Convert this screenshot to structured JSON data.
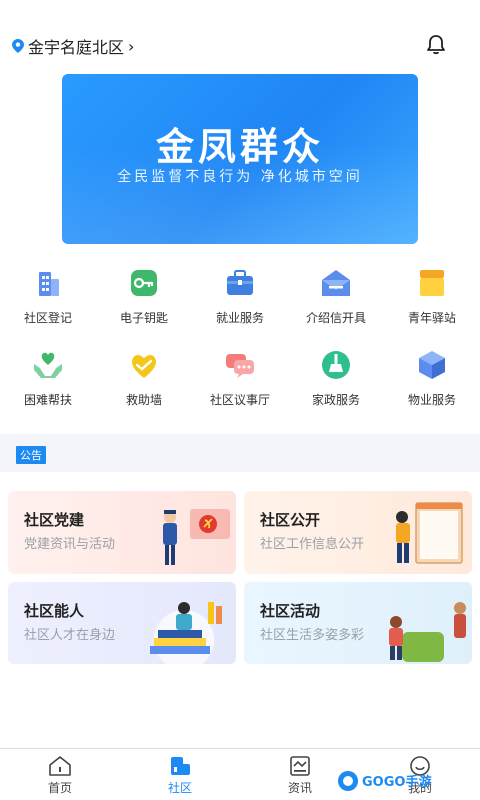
{
  "location": {
    "name": "金宇名庭北区"
  },
  "banner": {
    "title": "金凤群众",
    "subtitle": "全民监督不良行为  净化城市空间"
  },
  "services": [
    {
      "label": "社区登记",
      "icon": "building-icon"
    },
    {
      "label": "电子钥匙",
      "icon": "key-icon"
    },
    {
      "label": "就业服务",
      "icon": "briefcase-icon"
    },
    {
      "label": "介绍信开具",
      "icon": "letter-icon"
    },
    {
      "label": "青年驿站",
      "icon": "youth-station-icon"
    },
    {
      "label": "困难帮扶",
      "icon": "heart-hands-icon"
    },
    {
      "label": "救助墙",
      "icon": "handshake-heart-icon"
    },
    {
      "label": "社区议事厅",
      "icon": "chat-bubbles-icon"
    },
    {
      "label": "家政服务",
      "icon": "broom-icon"
    },
    {
      "label": "物业服务",
      "icon": "cube-icon"
    }
  ],
  "notice": {
    "badge": "公告"
  },
  "cards": [
    {
      "title": "社区党建",
      "subtitle": "党建资讯与活动"
    },
    {
      "title": "社区公开",
      "subtitle": "社区工作信息公开"
    },
    {
      "title": "社区能人",
      "subtitle": "社区人才在身边"
    },
    {
      "title": "社区活动",
      "subtitle": "社区生活多姿多彩"
    }
  ],
  "tabbar": {
    "active": "社区",
    "items": [
      {
        "label": "首页",
        "icon": "home-icon"
      },
      {
        "label": "社区",
        "icon": "community-icon"
      },
      {
        "label": "资讯",
        "icon": "news-icon"
      },
      {
        "label": "我的",
        "icon": "profile-icon"
      }
    ]
  },
  "watermark": {
    "text": "GOGO手游网"
  },
  "colors": {
    "accent": "#1c8af2",
    "banner": "#2a9bff",
    "notice_bg": "#f3f5fb"
  }
}
